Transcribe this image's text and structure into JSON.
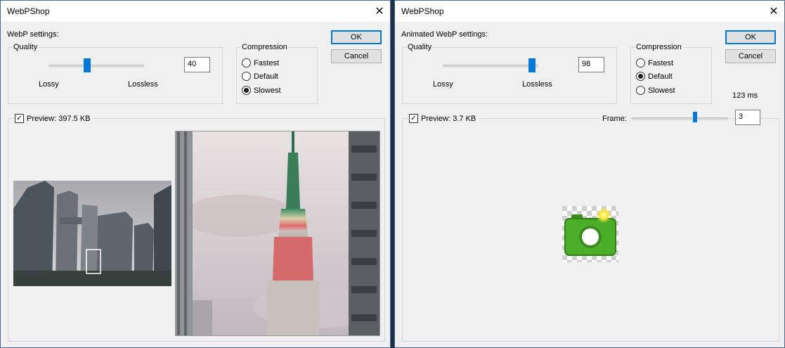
{
  "left_dialog": {
    "title": "WebPShop",
    "close_glyph": "✕",
    "settings_label": "WebP settings:",
    "quality": {
      "group_label": "Quality",
      "value": "40",
      "slider_fraction": 0.4,
      "min_label": "Lossy",
      "max_label": "Lossless"
    },
    "compression": {
      "group_label": "Compression",
      "options": [
        "Fastest",
        "Default",
        "Slowest"
      ],
      "selected": "Slowest"
    },
    "ok_label": "OK",
    "cancel_label": "Cancel",
    "preview": {
      "checked": true,
      "label": "Preview: 397.5 KB"
    }
  },
  "right_dialog": {
    "title": "WebPShop",
    "close_glyph": "✕",
    "settings_label": "Animated WebP settings:",
    "quality": {
      "group_label": "Quality",
      "value": "98",
      "slider_fraction": 0.98,
      "min_label": "Lossy",
      "max_label": "Lossless"
    },
    "compression": {
      "group_label": "Compression",
      "options": [
        "Fastest",
        "Default",
        "Slowest"
      ],
      "selected": "Default"
    },
    "ok_label": "OK",
    "cancel_label": "Cancel",
    "frame_duration": "123 ms",
    "preview": {
      "checked": true,
      "label": "Preview: 3.7 KB"
    },
    "frame": {
      "label": "Frame:",
      "value": "3"
    }
  },
  "colors": {
    "accent": "#0078d7",
    "dialog_bg": "#f0f0f0",
    "camera_icon": "#4caf2a"
  },
  "icons": [
    "close-icon",
    "checkbox-checked-icon",
    "camera-icon"
  ]
}
